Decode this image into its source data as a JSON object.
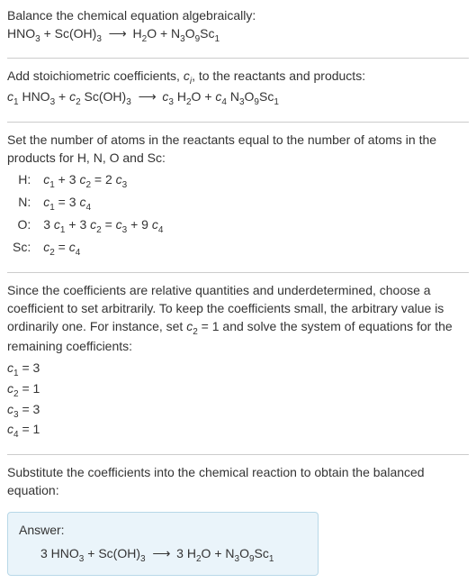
{
  "step1": {
    "title": "Balance the chemical equation algebraically:",
    "equation_html": "HNO<span class='sub'>3</span> + Sc(OH)<span class='sub'>3</span> &nbsp;<span class='arrow'>⟶</span>&nbsp; H<span class='sub'>2</span>O + N<span class='sub'>3</span>O<span class='sub'>9</span>Sc<span class='sub'>1</span>"
  },
  "step2": {
    "title_html": "Add stoichiometric coefficients, <span class='ital'>c<span class='sub'>i</span></span>, to the reactants and products:",
    "equation_html": "<span class='ital'>c</span><span class='sub'>1</span> HNO<span class='sub'>3</span> + <span class='ital'>c</span><span class='sub'>2</span> Sc(OH)<span class='sub'>3</span> &nbsp;<span class='arrow'>⟶</span>&nbsp; <span class='ital'>c</span><span class='sub'>3</span> H<span class='sub'>2</span>O + <span class='ital'>c</span><span class='sub'>4</span> N<span class='sub'>3</span>O<span class='sub'>9</span>Sc<span class='sub'>1</span>"
  },
  "step3": {
    "title": "Set the number of atoms in the reactants equal to the number of atoms in the products for H, N, O and Sc:",
    "rows": [
      {
        "el": "H:",
        "eq_html": "<span class='ital'>c</span><span class='sub'>1</span> + 3 <span class='ital'>c</span><span class='sub'>2</span> = 2 <span class='ital'>c</span><span class='sub'>3</span>"
      },
      {
        "el": "N:",
        "eq_html": "<span class='ital'>c</span><span class='sub'>1</span> = 3 <span class='ital'>c</span><span class='sub'>4</span>"
      },
      {
        "el": "O:",
        "eq_html": "3 <span class='ital'>c</span><span class='sub'>1</span> + 3 <span class='ital'>c</span><span class='sub'>2</span> = <span class='ital'>c</span><span class='sub'>3</span> + 9 <span class='ital'>c</span><span class='sub'>4</span>"
      },
      {
        "el": "Sc:",
        "eq_html": "<span class='ital'>c</span><span class='sub'>2</span> = <span class='ital'>c</span><span class='sub'>4</span>"
      }
    ]
  },
  "step4": {
    "title_html": "Since the coefficients are relative quantities and underdetermined, choose a coefficient to set arbitrarily. To keep the coefficients small, the arbitrary value is ordinarily one. For instance, set <span class='ital'>c</span><span class='sub'>2</span> = 1 and solve the system of equations for the remaining coefficients:",
    "coefs": [
      {
        "html": "<span class='ital'>c</span><span class='sub'>1</span> = 3"
      },
      {
        "html": "<span class='ital'>c</span><span class='sub'>2</span> = 1"
      },
      {
        "html": "<span class='ital'>c</span><span class='sub'>3</span> = 3"
      },
      {
        "html": "<span class='ital'>c</span><span class='sub'>4</span> = 1"
      }
    ]
  },
  "step5": {
    "title": "Substitute the coefficients into the chemical reaction to obtain the balanced equation:"
  },
  "answer": {
    "label": "Answer:",
    "equation_html": "3 HNO<span class='sub'>3</span> + Sc(OH)<span class='sub'>3</span> &nbsp;<span class='arrow'>⟶</span>&nbsp; 3 H<span class='sub'>2</span>O + N<span class='sub'>3</span>O<span class='sub'>9</span>Sc<span class='sub'>1</span>"
  }
}
